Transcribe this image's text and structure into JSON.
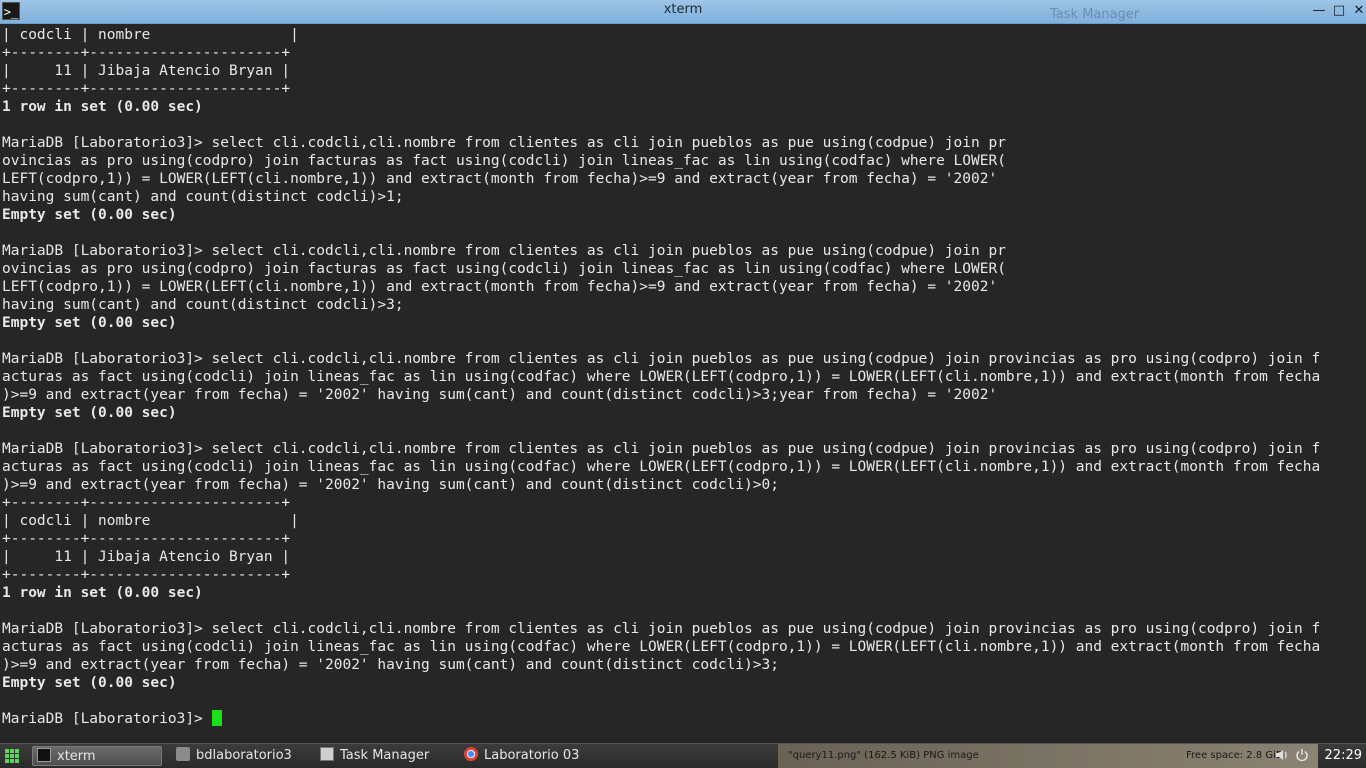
{
  "window": {
    "title": "xterm",
    "app_icon_glyph": ">_",
    "background_ghost_text": "Task Manager",
    "minimize_glyph": "—",
    "maximize_glyph": "□",
    "close_glyph": "✕"
  },
  "terminal": {
    "lines": [
      {
        "text": "| codcli | nombre                |",
        "bold": false
      },
      {
        "text": "+--------+----------------------+",
        "bold": false
      },
      {
        "text": "|     11 | Jibaja Atencio Bryan |",
        "bold": false
      },
      {
        "text": "+--------+----------------------+",
        "bold": false
      },
      {
        "text": "1 row in set (0.00 sec)",
        "bold": true
      },
      {
        "text": "",
        "bold": false
      },
      {
        "text": "MariaDB [Laboratorio3]> select cli.codcli,cli.nombre from clientes as cli join pueblos as pue using(codpue) join pr",
        "bold": false
      },
      {
        "text": "ovincias as pro using(codpro) join facturas as fact using(codcli) join lineas_fac as lin using(codfac) where LOWER(",
        "bold": false
      },
      {
        "text": "LEFT(codpro,1)) = LOWER(LEFT(cli.nombre,1)) and extract(month from fecha)>=9 and extract(year from fecha) = '2002'",
        "bold": false
      },
      {
        "text": "having sum(cant) and count(distinct codcli)>1;",
        "bold": false
      },
      {
        "text": "Empty set (0.00 sec)",
        "bold": true
      },
      {
        "text": "",
        "bold": false
      },
      {
        "text": "MariaDB [Laboratorio3]> select cli.codcli,cli.nombre from clientes as cli join pueblos as pue using(codpue) join pr",
        "bold": false
      },
      {
        "text": "ovincias as pro using(codpro) join facturas as fact using(codcli) join lineas_fac as lin using(codfac) where LOWER(",
        "bold": false
      },
      {
        "text": "LEFT(codpro,1)) = LOWER(LEFT(cli.nombre,1)) and extract(month from fecha)>=9 and extract(year from fecha) = '2002'",
        "bold": false
      },
      {
        "text": "having sum(cant) and count(distinct codcli)>3;",
        "bold": false
      },
      {
        "text": "Empty set (0.00 sec)",
        "bold": true
      },
      {
        "text": "",
        "bold": false
      },
      {
        "text": "MariaDB [Laboratorio3]> select cli.codcli,cli.nombre from clientes as cli join pueblos as pue using(codpue) join provincias as pro using(codpro) join f",
        "bold": false
      },
      {
        "text": "acturas as fact using(codcli) join lineas_fac as lin using(codfac) where LOWER(LEFT(codpro,1)) = LOWER(LEFT(cli.nombre,1)) and extract(month from fecha",
        "bold": false
      },
      {
        "text": ")>=9 and extract(year from fecha) = '2002' having sum(cant) and count(distinct codcli)>3;year from fecha) = '2002'",
        "bold": false
      },
      {
        "text": "Empty set (0.00 sec)",
        "bold": true
      },
      {
        "text": "",
        "bold": false
      },
      {
        "text": "MariaDB [Laboratorio3]> select cli.codcli,cli.nombre from clientes as cli join pueblos as pue using(codpue) join provincias as pro using(codpro) join f",
        "bold": false
      },
      {
        "text": "acturas as fact using(codcli) join lineas_fac as lin using(codfac) where LOWER(LEFT(codpro,1)) = LOWER(LEFT(cli.nombre,1)) and extract(month from fecha",
        "bold": false
      },
      {
        "text": ")>=9 and extract(year from fecha) = '2002' having sum(cant) and count(distinct codcli)>0;",
        "bold": false
      },
      {
        "text": "+--------+----------------------+",
        "bold": false
      },
      {
        "text": "| codcli | nombre                |",
        "bold": false
      },
      {
        "text": "+--------+----------------------+",
        "bold": false
      },
      {
        "text": "|     11 | Jibaja Atencio Bryan |",
        "bold": false
      },
      {
        "text": "+--------+----------------------+",
        "bold": false
      },
      {
        "text": "1 row in set (0.00 sec)",
        "bold": true
      },
      {
        "text": "",
        "bold": false
      },
      {
        "text": "MariaDB [Laboratorio3]> select cli.codcli,cli.nombre from clientes as cli join pueblos as pue using(codpue) join provincias as pro using(codpro) join f",
        "bold": false
      },
      {
        "text": "acturas as fact using(codcli) join lineas_fac as lin using(codfac) where LOWER(LEFT(codpro,1)) = LOWER(LEFT(cli.nombre,1)) and extract(month from fecha",
        "bold": false
      },
      {
        "text": ")>=9 and extract(year from fecha) = '2002' having sum(cant) and count(distinct codcli)>3;",
        "bold": false
      },
      {
        "text": "Empty set (0.00 sec)",
        "bold": true
      },
      {
        "text": "",
        "bold": false
      }
    ],
    "prompt": "MariaDB [Laboratorio3]> ",
    "cursor_color": "#19e019"
  },
  "taskbar": {
    "tasks": [
      {
        "label": "xterm",
        "icon": "terminal-icon",
        "active": true
      },
      {
        "label": "bdlaboratorio3",
        "icon": "folder-icon",
        "active": false
      },
      {
        "label": "Task Manager",
        "icon": "task-manager-icon",
        "active": false
      },
      {
        "label": "Laboratorio 03",
        "icon": "chrome-icon",
        "active": false
      }
    ],
    "notice": "\"query11.png\" (162.5 KiB) PNG image",
    "free_space": "Free space: 2.8 GiB",
    "clock": "22:29"
  }
}
